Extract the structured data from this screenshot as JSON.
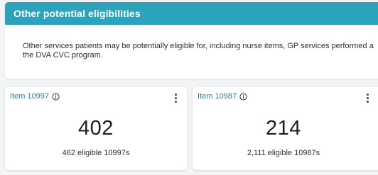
{
  "panel": {
    "title": "Other potential eligibilities",
    "description_line1": "Other services patients may be potentially eligible for, including nurse items, GP services performed a",
    "description_line2": "the DVA CVC program.",
    "header_color": "#2ca3bd"
  },
  "cards": [
    {
      "title": "Item 10997",
      "info_icon": "info-icon",
      "menu_icon": "kebab-menu-icon",
      "value": "402",
      "subtitle": "462 eligible 10997s"
    },
    {
      "title": "Item 10987",
      "info_icon": "info-icon",
      "menu_icon": "kebab-menu-icon",
      "value": "214",
      "subtitle": "2,111 eligible 10987s"
    }
  ]
}
